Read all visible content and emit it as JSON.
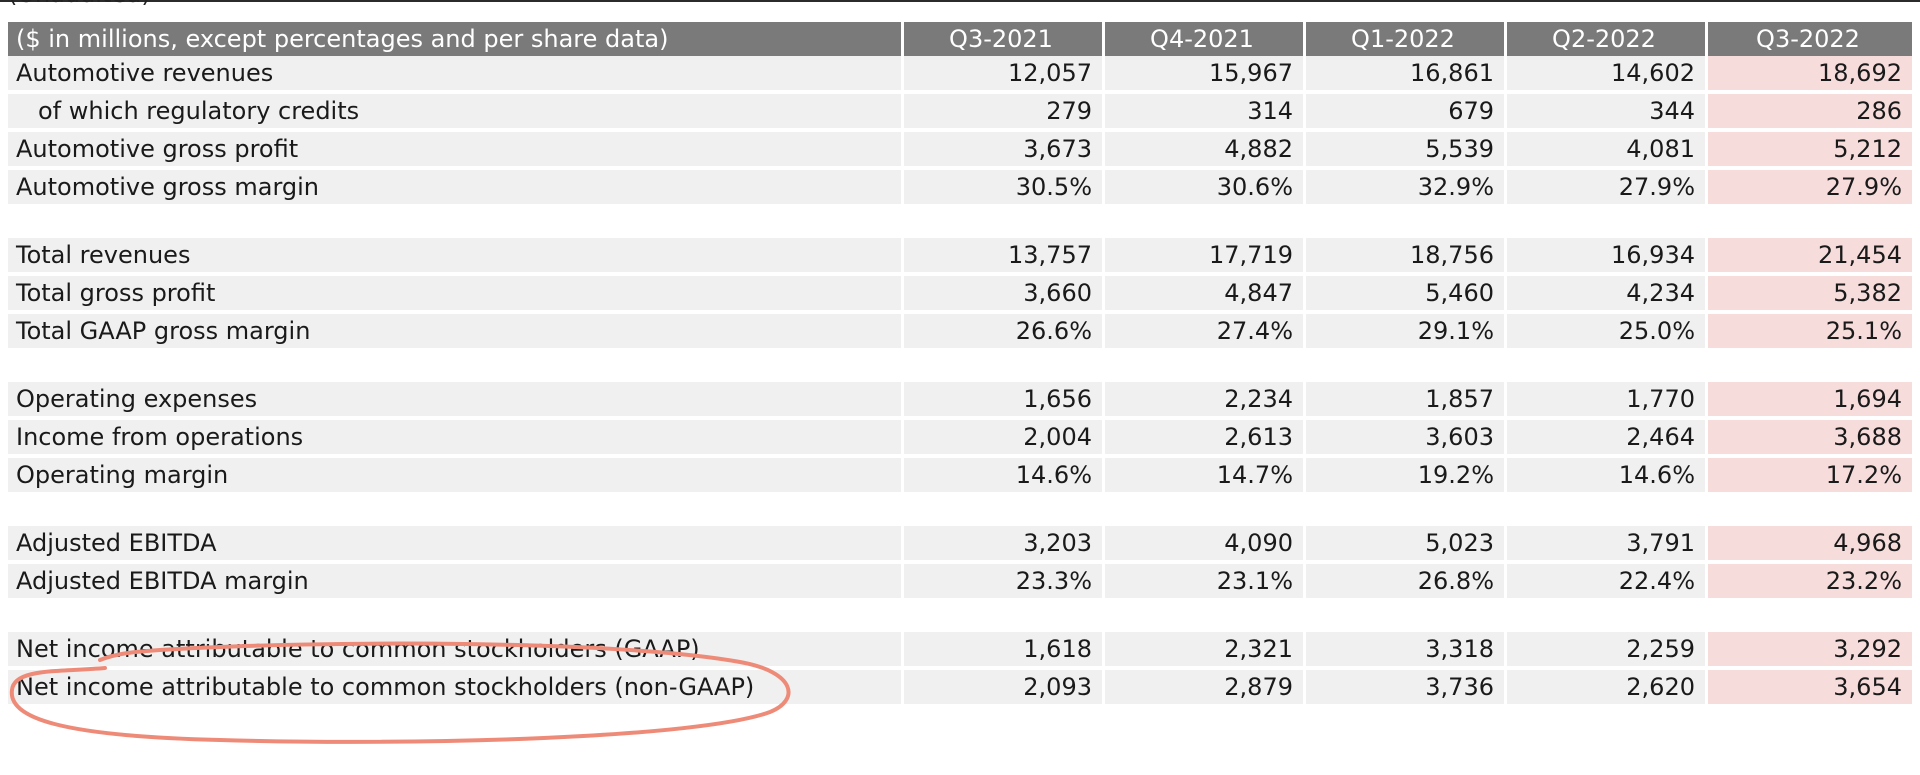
{
  "note": "(Unaudited)",
  "table": {
    "header_label": "($ in millions, except percentages and per share data)",
    "columns": [
      "Q3-2021",
      "Q4-2021",
      "Q1-2022",
      "Q2-2022",
      "Q3-2022"
    ],
    "sections": [
      [
        {
          "label": "Automotive revenues",
          "indent": false,
          "values": [
            "12,057",
            "15,967",
            "16,861",
            "14,602",
            "18,692"
          ]
        },
        {
          "label": "of which regulatory credits",
          "indent": true,
          "values": [
            "279",
            "314",
            "679",
            "344",
            "286"
          ]
        },
        {
          "label": "Automotive gross profit",
          "indent": false,
          "values": [
            "3,673",
            "4,882",
            "5,539",
            "4,081",
            "5,212"
          ]
        },
        {
          "label": "Automotive gross margin",
          "indent": false,
          "values": [
            "30.5%",
            "30.6%",
            "32.9%",
            "27.9%",
            "27.9%"
          ]
        }
      ],
      [
        {
          "label": "Total revenues",
          "indent": false,
          "values": [
            "13,757",
            "17,719",
            "18,756",
            "16,934",
            "21,454"
          ]
        },
        {
          "label": "Total gross profit",
          "indent": false,
          "values": [
            "3,660",
            "4,847",
            "5,460",
            "4,234",
            "5,382"
          ]
        },
        {
          "label": "Total GAAP gross margin",
          "indent": false,
          "values": [
            "26.6%",
            "27.4%",
            "29.1%",
            "25.0%",
            "25.1%"
          ]
        }
      ],
      [
        {
          "label": "Operating expenses",
          "indent": false,
          "values": [
            "1,656",
            "2,234",
            "1,857",
            "1,770",
            "1,694"
          ]
        },
        {
          "label": "Income from operations",
          "indent": false,
          "values": [
            "2,004",
            "2,613",
            "3,603",
            "2,464",
            "3,688"
          ]
        },
        {
          "label": "Operating margin",
          "indent": false,
          "values": [
            "14.6%",
            "14.7%",
            "19.2%",
            "14.6%",
            "17.2%"
          ]
        }
      ],
      [
        {
          "label": "Adjusted EBITDA",
          "indent": false,
          "values": [
            "3,203",
            "4,090",
            "5,023",
            "3,791",
            "4,968"
          ]
        },
        {
          "label": "Adjusted EBITDA margin",
          "indent": false,
          "values": [
            "23.3%",
            "23.1%",
            "26.8%",
            "22.4%",
            "23.2%"
          ]
        }
      ],
      [
        {
          "label": "Net income attributable to common stockholders (GAAP)",
          "indent": false,
          "values": [
            "1,618",
            "2,321",
            "3,318",
            "2,259",
            "3,292"
          ]
        },
        {
          "label": "Net income attributable to common stockholders (non-GAAP)",
          "indent": false,
          "values": [
            "2,093",
            "2,879",
            "3,736",
            "2,620",
            "3,654"
          ]
        }
      ]
    ]
  },
  "colors": {
    "header_bg": "#7a7a7a",
    "row_bg": "#f0f0f0",
    "highlight_column": "#f7dcdc",
    "annotation_stroke": "#ee8b78"
  }
}
